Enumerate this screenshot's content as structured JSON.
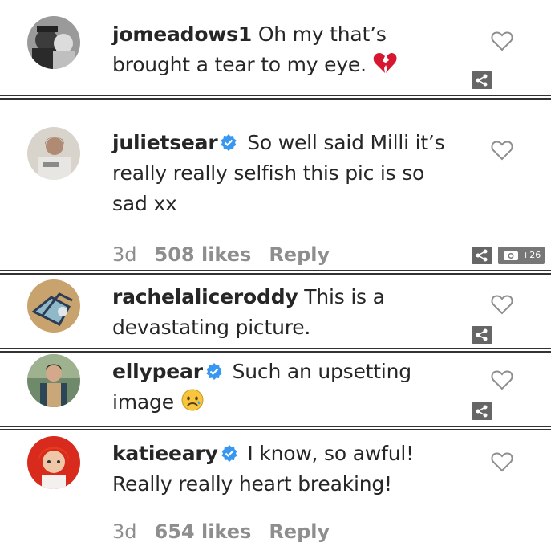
{
  "comments": [
    {
      "username": "jomeadows1",
      "verified": false,
      "text": "Oh my that’s brought a tear to my eye.",
      "emoji": "broken-heart"
    },
    {
      "username": "julietsear",
      "verified": true,
      "text": "So well said Milli it’s really really selfish this pic is so sad xx",
      "meta": {
        "age": "3d",
        "likes": "508 likes",
        "reply": "Reply"
      }
    },
    {
      "username": "rachelaliceroddy",
      "verified": false,
      "text": "This is a devastating picture."
    },
    {
      "username": "ellypear",
      "verified": true,
      "text": "Such an upsetting image",
      "emoji": "sad-face"
    },
    {
      "username": "katieeary",
      "verified": true,
      "text": "I know, so awful! Really really heart breaking!",
      "meta": {
        "age": "3d",
        "likes": "654 likes",
        "reply": "Reply"
      }
    }
  ],
  "photo_badge": "+26",
  "colors": {
    "verified": "#3897f0",
    "heart_outline": "#8e8e8e",
    "broken_heart": "#d7172f"
  }
}
